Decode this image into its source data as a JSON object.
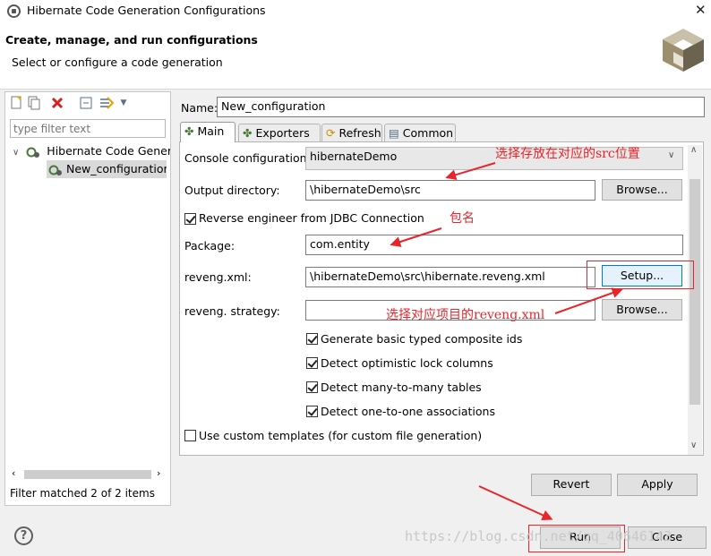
{
  "window": {
    "title": "Hibernate Code Generation Configurations",
    "close": "✕"
  },
  "header": {
    "title": "Create, manage, and run configurations",
    "subtitle": "Select or configure a code generation"
  },
  "left": {
    "toolbar": [
      "new-icon",
      "duplicate-icon",
      "delete-icon",
      "collapse-all-icon",
      "filter-icon",
      "dropdown-icon"
    ],
    "filter_placeholder": "type filter text",
    "tree": {
      "parent": "Hibernate Code Gener",
      "child": "New_configuration"
    },
    "status": "Filter matched 2 of 2 items"
  },
  "form": {
    "name_label": "Name:",
    "name_value": "New_configuration",
    "tabs": [
      "Main",
      "Exporters",
      "Refresh",
      "Common"
    ],
    "console_label": "Console configuration:",
    "console_value": "hibernateDemo",
    "output_label": "Output directory:",
    "output_value": "\\hibernateDemo\\src",
    "browse": "Browse...",
    "reverse_label": "Reverse engineer from JDBC Connection",
    "package_label": "Package:",
    "package_value": "com.entity",
    "reveng_label": "reveng.xml:",
    "reveng_value": "\\hibernateDemo\\src\\hibernate.reveng.xml",
    "setup": "Setup...",
    "strategy_label": "reveng. strategy:",
    "strategy_value": "",
    "options": [
      "Generate basic typed composite ids",
      "Detect optimistic lock columns",
      "Detect many-to-many tables",
      "Detect one-to-one associations",
      "Use custom templates (for custom file generation)"
    ],
    "options_checked": [
      true,
      true,
      true,
      true,
      false
    ]
  },
  "buttons": {
    "revert": "Revert",
    "apply": "Apply",
    "run": "Run",
    "close": "Close"
  },
  "annotations": {
    "console_note": "选择存放在对应的src位置",
    "package_note": "包名",
    "reveng_note": "选择对应项目的reveng.xml"
  },
  "watermark": "https://blog.csdn.net/qq_40646143",
  "colors": {
    "annotation": "#e8252b",
    "focus": "#0078d7"
  }
}
